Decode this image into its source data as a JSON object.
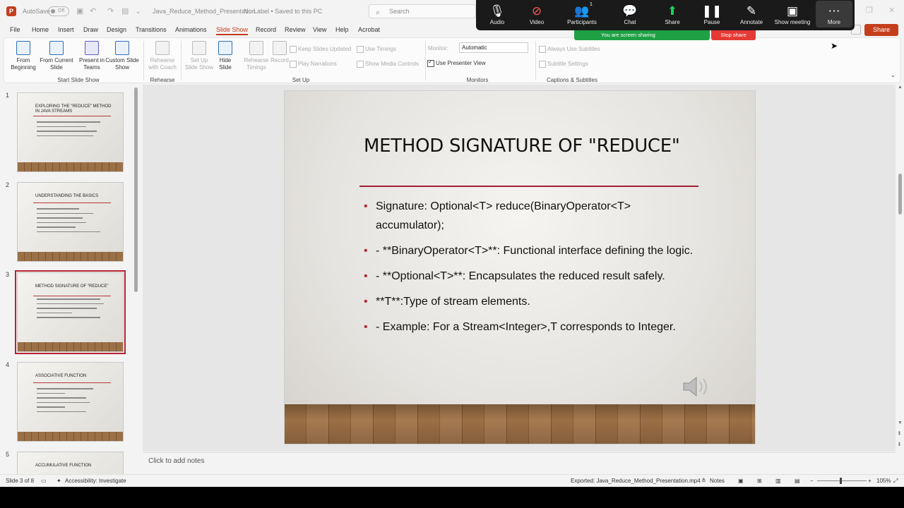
{
  "titlebar": {
    "app_logo": "P",
    "autosave_label": "AutoSave",
    "autosave_state": "Off",
    "doc_title": "Java_Reduce_Method_Presentation",
    "label_status": "No Label • Saved to this PC",
    "search_placeholder": "Search"
  },
  "menu": {
    "tabs": [
      "File",
      "Home",
      "Insert",
      "Draw",
      "Design",
      "Transitions",
      "Animations",
      "Slide Show",
      "Record",
      "Review",
      "View",
      "Help",
      "Acrobat"
    ],
    "active_tab": "Slide Show",
    "share_label": "Share"
  },
  "ribbon": {
    "from_beginning": "From Beginning",
    "from_current": "From Current Slide",
    "present_teams": "Present in Teams",
    "custom_show": "Custom Slide Show",
    "group_start": "Start Slide Show",
    "rehearse_coach": "Rehearse with Coach",
    "group_rehearse": "Rehearse",
    "setup_show": "Set Up Slide Show",
    "hide_slide": "Hide Slide",
    "rehearse_timings": "Rehearse Timings",
    "record": "Record",
    "keep_updated": "Keep Slides Updated",
    "use_timings": "Use Timings",
    "play_narrations": "Play Narrations",
    "show_media": "Show Media Controls",
    "group_setup": "Set Up",
    "monitor_label": "Monitor:",
    "monitor_value": "Automatic",
    "use_presenter": "Use Presenter View",
    "group_monitors": "Monitors",
    "always_subtitles": "Always Use Subtitles",
    "subtitle_settings": "Subtitle Settings",
    "group_captions": "Captions & Subtitles"
  },
  "zoom": {
    "audio": "Audio",
    "video": "Video",
    "participants": "Participants",
    "participants_count": "1",
    "chat": "Chat",
    "share": "Share",
    "pause": "Pause",
    "annotate": "Annotate",
    "show_meeting": "Show meeting",
    "more": "More",
    "sharing_status": "You are screen sharing",
    "stop_share": "Stop share"
  },
  "thumbnails": [
    {
      "num": "1",
      "title": "EXPLORING THE \"REDUCE\" METHOD IN JAVA STREAMS",
      "lines": 4
    },
    {
      "num": "2",
      "title": "UNDERSTANDING THE BASICS",
      "lines": 6
    },
    {
      "num": "3",
      "title": "METHOD SIGNATURE OF \"REDUCE\"",
      "lines": 5
    },
    {
      "num": "4",
      "title": "ASSOCIATIVE FUNCTION",
      "lines": 6
    },
    {
      "num": "5",
      "title": "ACCUMULATIVE FUNCTION",
      "lines": 0
    }
  ],
  "slide": {
    "title": "METHOD SIGNATURE OF \"REDUCE\"",
    "bullets": [
      "Signature: Optional<T> reduce(BinaryOperator<T> accumulator);",
      "- **BinaryOperator<T>**: Functional interface defining the logic.",
      "- **Optional<T>**: Encapsulates the reduced result safely.",
      "**T**:Type of stream elements.",
      "- Example: For a Stream<Integer>,T corresponds to Integer."
    ]
  },
  "notes_placeholder": "Click to add notes",
  "status": {
    "slide_indicator": "Slide 3 of 8",
    "accessibility": "Accessibility: Investigate",
    "exported": "Exported: Java_Reduce_Method_Presentation.mp4",
    "notes_label": "Notes",
    "zoom_level": "105%"
  },
  "colors": {
    "accent": "#c43e1c",
    "zoom_bar": "#1a1a1a",
    "sharing_green": "#1fa045",
    "stop_red": "#e53935",
    "slide_rule": "#a32035"
  }
}
